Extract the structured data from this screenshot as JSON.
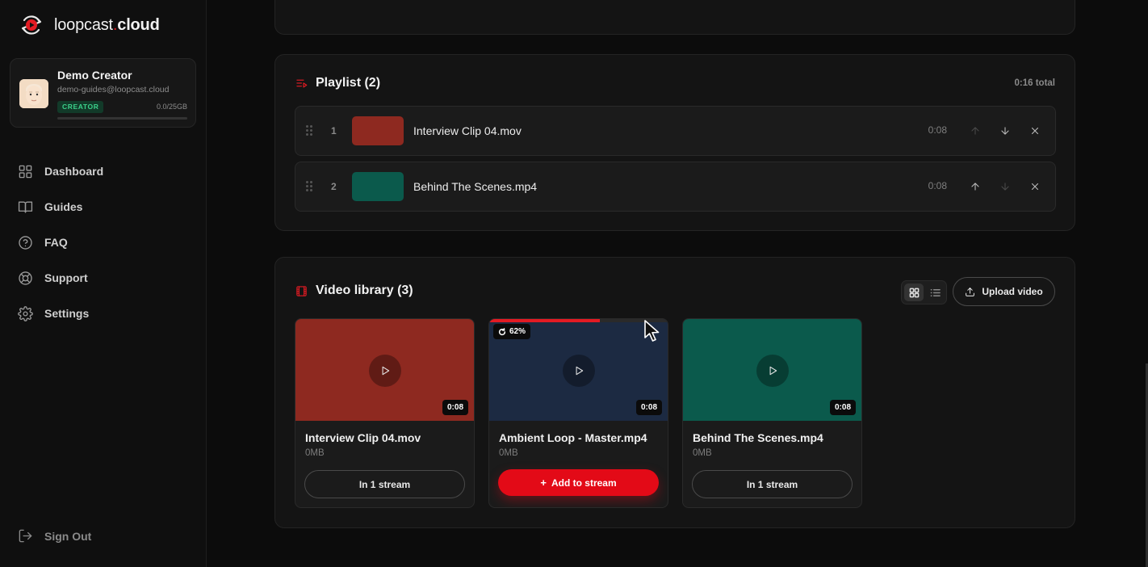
{
  "app": {
    "logo_name": "loopcast",
    "logo_dot": ".",
    "logo_tld": "cloud"
  },
  "profile": {
    "name": "Demo Creator",
    "email": "demo-guides@loopcast.cloud",
    "role": "CREATOR",
    "storage": "0.0/25GB",
    "storage_used_fraction": 0.0
  },
  "nav": {
    "items": [
      {
        "label": "Dashboard",
        "icon": "grid-icon"
      },
      {
        "label": "Guides",
        "icon": "book-icon"
      },
      {
        "label": "FAQ",
        "icon": "help-circle-icon"
      },
      {
        "label": "Support",
        "icon": "lifebuoy-icon"
      },
      {
        "label": "Settings",
        "icon": "gear-icon"
      }
    ],
    "sign_out": "Sign Out"
  },
  "playlist": {
    "title": "Playlist (2)",
    "total": "0:16 total",
    "items": [
      {
        "index": "1",
        "name": "Interview Clip 04.mov",
        "duration": "0:08",
        "color": "#8e2920",
        "can_move_up": false,
        "can_move_down": true
      },
      {
        "index": "2",
        "name": "Behind The Scenes.mp4",
        "duration": "0:08",
        "color": "#0b5a4c",
        "can_move_up": true,
        "can_move_down": false
      }
    ]
  },
  "library": {
    "title": "Video library (3)",
    "upload_label": "Upload video",
    "view_mode": "grid",
    "videos": [
      {
        "name": "Interview Clip 04.mov",
        "size": "0MB",
        "duration": "0:08",
        "color": "#8e2920",
        "action": "In 1 stream",
        "action_style": "outline"
      },
      {
        "name": "Ambient Loop - Master.mp4",
        "size": "0MB",
        "duration": "0:08",
        "color": "#1c2a42",
        "action": "Add to stream",
        "action_style": "primary",
        "processing_label": "62%",
        "processing_fraction": 0.62
      },
      {
        "name": "Behind The Scenes.mp4",
        "size": "0MB",
        "duration": "0:08",
        "color": "#0b5a4c",
        "action": "In 1 stream",
        "action_style": "outline"
      }
    ]
  },
  "colors": {
    "accent": "#e31b23",
    "creator_badge": "#3bd08a"
  }
}
